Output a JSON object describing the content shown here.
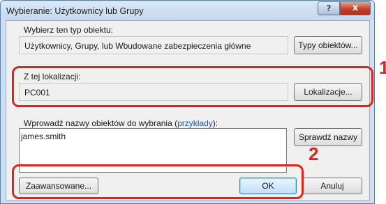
{
  "window": {
    "title": "Wybieranie: Użytkownicy lub Grupy",
    "help_glyph": "?",
    "close_glyph": "x"
  },
  "object_type": {
    "label": "Wybierz ten typ obiektu:",
    "value": "Użytkownicy, Grupy, lub Wbudowane zabezpieczenia główne",
    "button": "Typy obiektów..."
  },
  "location": {
    "label": "Z tej lokalizacji:",
    "value": "PC001",
    "button": "Lokalizacje..."
  },
  "names": {
    "label_prefix": "Wprowadź nazwy obiektów do wybrania (",
    "label_link": "przykłady",
    "label_suffix": "):",
    "value": "james.smith",
    "check_button": "Sprawdź nazwy"
  },
  "footer": {
    "advanced_button": "Zaawansowane...",
    "ok_button": "OK",
    "cancel_button": "Anuluj"
  },
  "callouts": {
    "first_number": "1",
    "second_number": "2",
    "color": "#e0231b"
  }
}
